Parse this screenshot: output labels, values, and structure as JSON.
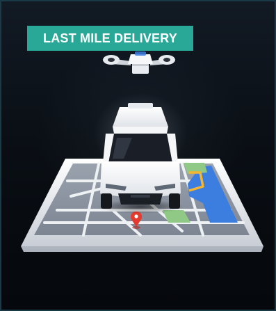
{
  "badge": {
    "label": "LAST MILE DELIVERY",
    "color": "#2aa897"
  },
  "scene": {
    "items": [
      "delivery-drone",
      "autonomous-vehicle",
      "tablet-map",
      "location-pin"
    ]
  },
  "colors": {
    "background": "#0a0d12",
    "tablet": "#f2f4f6",
    "map_base": "#8b93a1",
    "route": "#f2b632",
    "pin": "#e53b2e",
    "water": "#3c7de0",
    "park": "#8fc985"
  }
}
